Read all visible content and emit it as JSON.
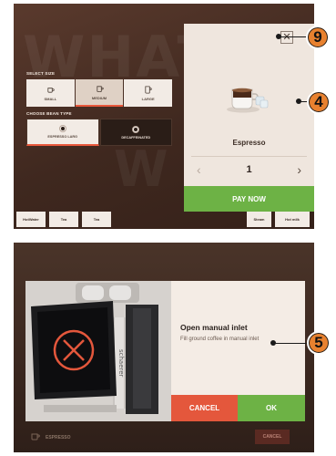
{
  "order_screen": {
    "background_text": "WHAT",
    "background_text2": "W",
    "select_size_label": "SELECT SIZE",
    "sizes": [
      {
        "label": "SMALL",
        "selected": false
      },
      {
        "label": "MEDIUM",
        "selected": true
      },
      {
        "label": "LARGE",
        "selected": false
      }
    ],
    "choose_bean_label": "CHOOSE BEAN TYPE",
    "beans": [
      {
        "label": "ESPRESSO LARG",
        "selected": true
      },
      {
        "label": "DECAFFEINATED",
        "selected": false
      }
    ],
    "bottom_buttons": [
      "HotWater",
      "Tea",
      "Tea",
      "Steam",
      "Hot milk"
    ],
    "card": {
      "close_symbol": "✕",
      "product_name": "Espresso",
      "quantity": "1",
      "prev_symbol": "‹",
      "next_symbol": "›",
      "pay_label": "PAY NOW"
    },
    "callouts": {
      "close": "9",
      "card": "4"
    }
  },
  "manual_inlet_screen": {
    "title": "Open manual inlet",
    "message": "Fill ground coffee in manual inlet",
    "machine_brand": "schaerer",
    "cancel_label": "CANCEL",
    "ok_label": "OK",
    "footer_left": "ESPRESSO",
    "footer_cancel": "CANCEL",
    "callout": "5"
  },
  "colors": {
    "accent_green": "#6db245",
    "accent_orange": "#e4573c",
    "callout_badge": "#e8812f",
    "brown_bg": "#4a3429"
  }
}
